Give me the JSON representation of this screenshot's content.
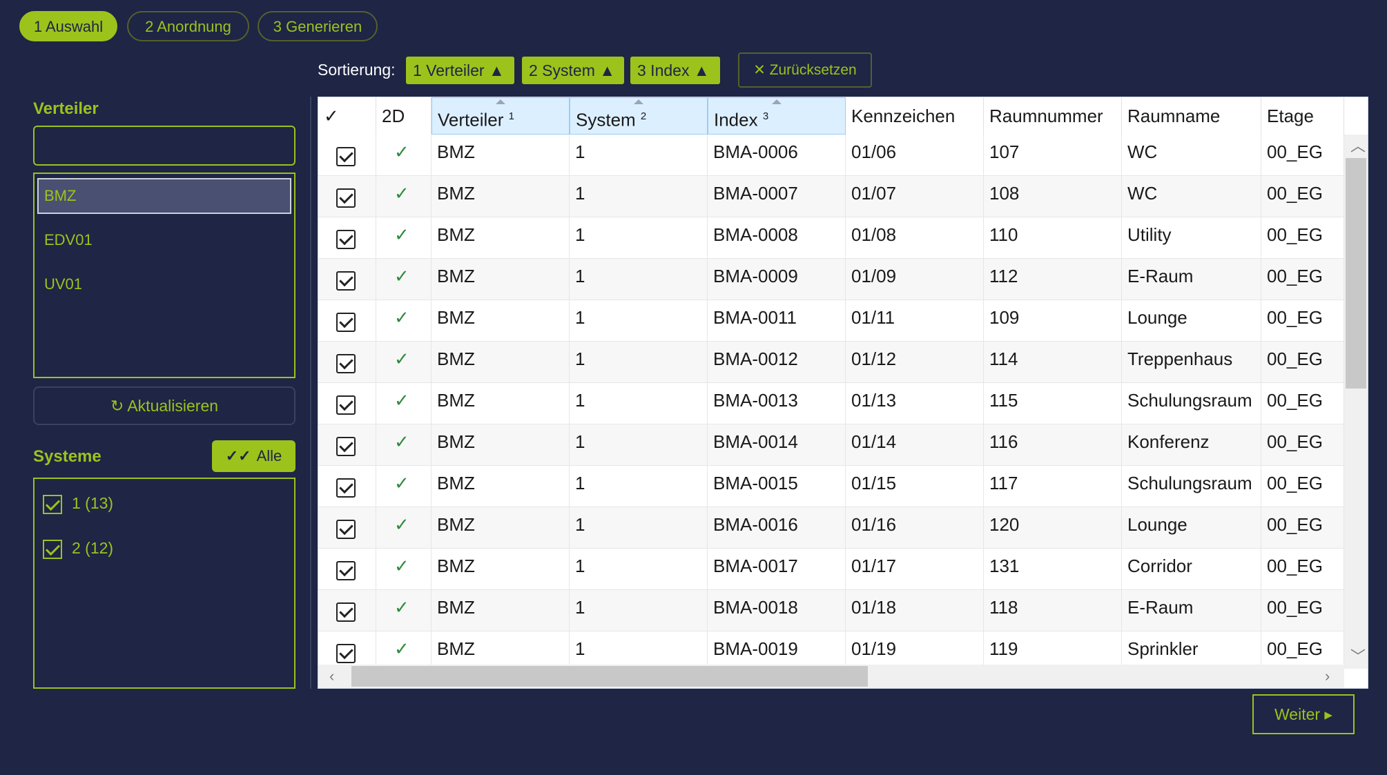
{
  "steps": [
    {
      "label": "1 Auswahl",
      "active": true
    },
    {
      "label": "2 Anordnung",
      "active": false
    },
    {
      "label": "3 Generieren",
      "active": false
    }
  ],
  "sort": {
    "label": "Sortierung:",
    "chips": [
      "1 Verteiler ▲",
      "2 System ▲",
      "3 Index ▲"
    ],
    "reset_label": "✕ Zurücksetzen"
  },
  "verteiler": {
    "title": "Verteiler",
    "search_value": "",
    "items": [
      "BMZ",
      "EDV01",
      "UV01"
    ],
    "selected": "BMZ",
    "refresh_label": "↻ Aktualisieren"
  },
  "systeme": {
    "title": "Systeme",
    "all_label": "Alle",
    "items": [
      {
        "label": "1  (13)",
        "checked": true
      },
      {
        "label": "2  (12)",
        "checked": true
      }
    ]
  },
  "table": {
    "columns": [
      {
        "label": "✓",
        "sort": ""
      },
      {
        "label": "2D",
        "sort": ""
      },
      {
        "label": "Verteiler",
        "sort": "1"
      },
      {
        "label": "System",
        "sort": "2"
      },
      {
        "label": "Index",
        "sort": "3"
      },
      {
        "label": "Kennzeichen",
        "sort": ""
      },
      {
        "label": "Raumnummer",
        "sort": ""
      },
      {
        "label": "Raumname",
        "sort": ""
      },
      {
        "label": "Etage",
        "sort": ""
      }
    ],
    "rows": [
      [
        "BMZ",
        "1",
        "BMA-0006",
        "01/06",
        "107",
        "WC",
        "00_EG"
      ],
      [
        "BMZ",
        "1",
        "BMA-0007",
        "01/07",
        "108",
        "WC",
        "00_EG"
      ],
      [
        "BMZ",
        "1",
        "BMA-0008",
        "01/08",
        "110",
        "Utility",
        "00_EG"
      ],
      [
        "BMZ",
        "1",
        "BMA-0009",
        "01/09",
        "112",
        "E-Raum",
        "00_EG"
      ],
      [
        "BMZ",
        "1",
        "BMA-0011",
        "01/11",
        "109",
        "Lounge",
        "00_EG"
      ],
      [
        "BMZ",
        "1",
        "BMA-0012",
        "01/12",
        "114",
        "Treppenhaus",
        "00_EG"
      ],
      [
        "BMZ",
        "1",
        "BMA-0013",
        "01/13",
        "115",
        "Schulungsraum",
        "00_EG"
      ],
      [
        "BMZ",
        "1",
        "BMA-0014",
        "01/14",
        "116",
        "Konferenz",
        "00_EG"
      ],
      [
        "BMZ",
        "1",
        "BMA-0015",
        "01/15",
        "117",
        "Schulungsraum",
        "00_EG"
      ],
      [
        "BMZ",
        "1",
        "BMA-0016",
        "01/16",
        "120",
        "Lounge",
        "00_EG"
      ],
      [
        "BMZ",
        "1",
        "BMA-0017",
        "01/17",
        "131",
        "Corridor",
        "00_EG"
      ],
      [
        "BMZ",
        "1",
        "BMA-0018",
        "01/18",
        "118",
        "E-Raum",
        "00_EG"
      ],
      [
        "BMZ",
        "1",
        "BMA-0019",
        "01/19",
        "119",
        "Sprinkler",
        "00_EG"
      ]
    ],
    "check_mark": "✓"
  },
  "footer": {
    "next_label": "Weiter ▸"
  },
  "colors": {
    "accent": "#9bc31c",
    "background": "#1e2545",
    "tick": "#2e8b3a"
  },
  "icons": {
    "refresh": "refresh-icon",
    "double_check": "double-check-icon",
    "close": "close-icon"
  }
}
